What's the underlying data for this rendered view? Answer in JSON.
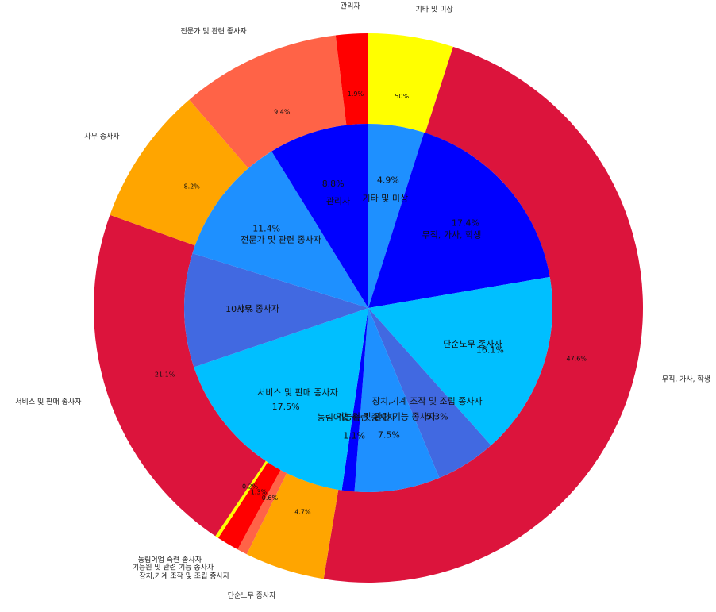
{
  "chart_data": {
    "type": "pie",
    "variant": "nested-donut",
    "title": "",
    "categories": [
      "기타 및 미상",
      "무직, 가사, 학생",
      "단순노무 종사자",
      "장치,기계 조작 및 조립 종사자",
      "기능원 및 관련 기능 종사자",
      "농림어업 숙련 종사자",
      "서비스 및 판매 종사자",
      "사무 종사자",
      "전문가 및 관련 종사자",
      "관리자"
    ],
    "outer_ring": {
      "values": [
        5.0,
        47.6,
        4.7,
        0.6,
        1.3,
        0.2,
        21.1,
        8.2,
        9.4,
        1.9
      ],
      "labels": [
        "50%",
        "47.6%",
        "4.7%",
        "0.6%",
        "1.3%",
        "0.2%",
        "21.1%",
        "8.2%",
        "9.4%",
        "1.9%"
      ],
      "colors": [
        "#ffff00",
        "#dc143c",
        "#ffa500",
        "#ff6347",
        "#ff0000",
        "#ffff00",
        "#dc143c",
        "#ffa500",
        "#ff6347",
        "#ff0000"
      ]
    },
    "inner_ring": {
      "values": [
        4.9,
        17.4,
        16.1,
        5.3,
        7.5,
        1.1,
        17.5,
        10.0,
        11.4,
        8.8
      ],
      "labels": [
        "4.9%",
        "17.4%",
        "16.1%",
        "5.3%",
        "7.5%",
        "1.1%",
        "17.5%",
        "10.0%",
        "11.4%",
        "8.8%"
      ],
      "colors": [
        "#1e90ff",
        "#0000ff",
        "#00bfff",
        "#4169e1",
        "#1e90ff",
        "#0000ff",
        "#00bfff",
        "#4169e1",
        "#1e90ff",
        "#0000ff"
      ]
    },
    "start_angle": "12 o'clock",
    "direction": "clockwise",
    "legend": "none"
  }
}
